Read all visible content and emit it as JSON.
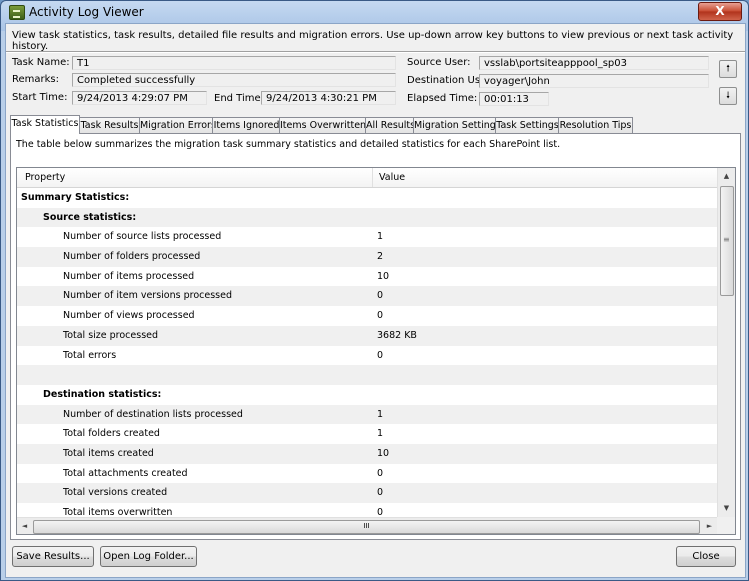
{
  "window": {
    "title": "Activity Log Viewer",
    "close_glyph": "X"
  },
  "description": "View task statistics, task results, detailed file results and migration errors. Use up-down arrow key buttons to view previous or next task activity history.",
  "info": {
    "task_name_label": "Task Name:",
    "task_name": "T1",
    "remarks_label": "Remarks:",
    "remarks": "Completed successfully",
    "start_label": "Start Time:",
    "start": "9/24/2013 4:29:07 PM",
    "end_label": "End Time:",
    "end": "9/24/2013 4:30:21 PM",
    "source_user_label": "Source User:",
    "source_user": "vsslab\\portsiteapppool_sp03",
    "dest_user_label": "Destination User:",
    "dest_user": "voyager\\John",
    "elapsed_label": "Elapsed Time:",
    "elapsed": "00:01:13",
    "prev_glyph": "🠕",
    "next_glyph": "🠗"
  },
  "tabs": [
    "Task Statistics",
    "Task Results",
    "Migration Errors",
    "Items Ignored",
    "Items Overwritten",
    "All Results",
    "Migration Settings",
    "Task Settings",
    "Resolution Tips"
  ],
  "intro": "The table below summarizes the migration task summary statistics and detailed statistics for each SharePoint list.",
  "table": {
    "col_property": "Property",
    "col_value": "Value",
    "rows": [
      {
        "p": "Summary Statistics:",
        "v": "",
        "level": 0,
        "bold": true
      },
      {
        "p": "Source statistics:",
        "v": "",
        "level": 1,
        "bold": true
      },
      {
        "p": "Number of source lists processed",
        "v": "1",
        "level": 2
      },
      {
        "p": "Number of folders processed",
        "v": "2",
        "level": 2
      },
      {
        "p": "Number of items processed",
        "v": "10",
        "level": 2
      },
      {
        "p": "Number of item versions processed",
        "v": "0",
        "level": 2
      },
      {
        "p": "Number of views processed",
        "v": "0",
        "level": 2
      },
      {
        "p": "Total size processed",
        "v": "3682 KB",
        "level": 2
      },
      {
        "p": "Total errors",
        "v": "0",
        "level": 2
      },
      {
        "p": "",
        "v": "",
        "level": 0
      },
      {
        "p": "Destination statistics:",
        "v": "",
        "level": 1,
        "bold": true
      },
      {
        "p": "Number of destination lists processed",
        "v": "1",
        "level": 2
      },
      {
        "p": "Total folders created",
        "v": "1",
        "level": 2
      },
      {
        "p": "Total items created",
        "v": "10",
        "level": 2
      },
      {
        "p": "Total attachments created",
        "v": "0",
        "level": 2
      },
      {
        "p": "Total versions created",
        "v": "0",
        "level": 2
      },
      {
        "p": "Total items overwritten",
        "v": "0",
        "level": 2
      }
    ]
  },
  "scroll_glyphs": {
    "up": "▲",
    "down": "▼",
    "left": "◄",
    "right": "►",
    "grip": "III",
    "vgrip": "≡"
  },
  "buttons": {
    "save": "Save Results...",
    "open_log": "Open Log Folder...",
    "close": "Close"
  }
}
